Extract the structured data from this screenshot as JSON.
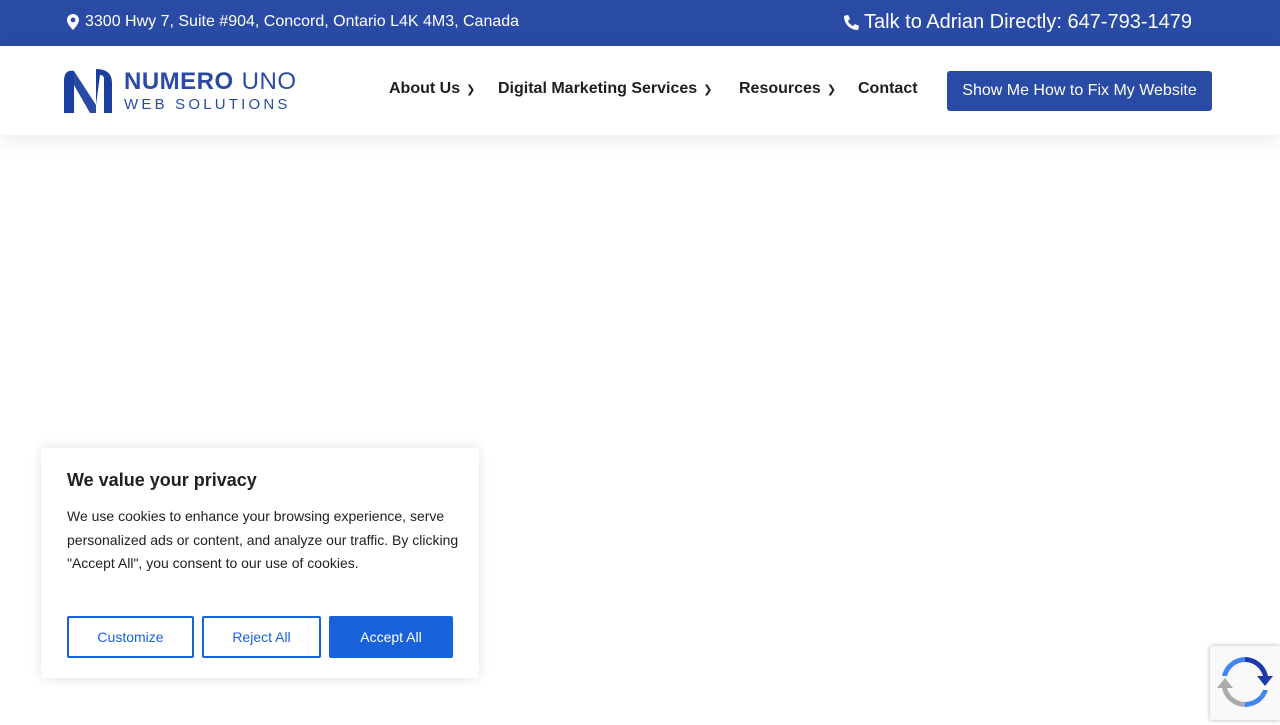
{
  "topbar": {
    "address": "3300 Hwy 7, Suite #904, Concord, Ontario L4K 4M3, Canada",
    "phone_text": "Talk to Adrian Directly: 647-793-1479",
    "address_icon": "map-marker-icon",
    "phone_icon": "phone-icon"
  },
  "logo": {
    "line1": "NUMERO",
    "line1b": "UNO",
    "line2": "WEB SOLUTIONS"
  },
  "nav": {
    "about": "About Us",
    "services": "Digital Marketing Services",
    "resources": "Resources",
    "contact": "Contact",
    "cta": "Show Me How to Fix My Website"
  },
  "cookie": {
    "title": "We value your privacy",
    "body": "We use cookies to enhance your browsing experience, serve personalized ads or content, and analyze our traffic. By clicking \"Accept All\", you consent to our use of cookies.",
    "customize": "Customize",
    "reject": "Reject All",
    "accept": "Accept All"
  },
  "colors": {
    "brand": "#2a4ba5",
    "cookie_accent": "#1863dc"
  }
}
